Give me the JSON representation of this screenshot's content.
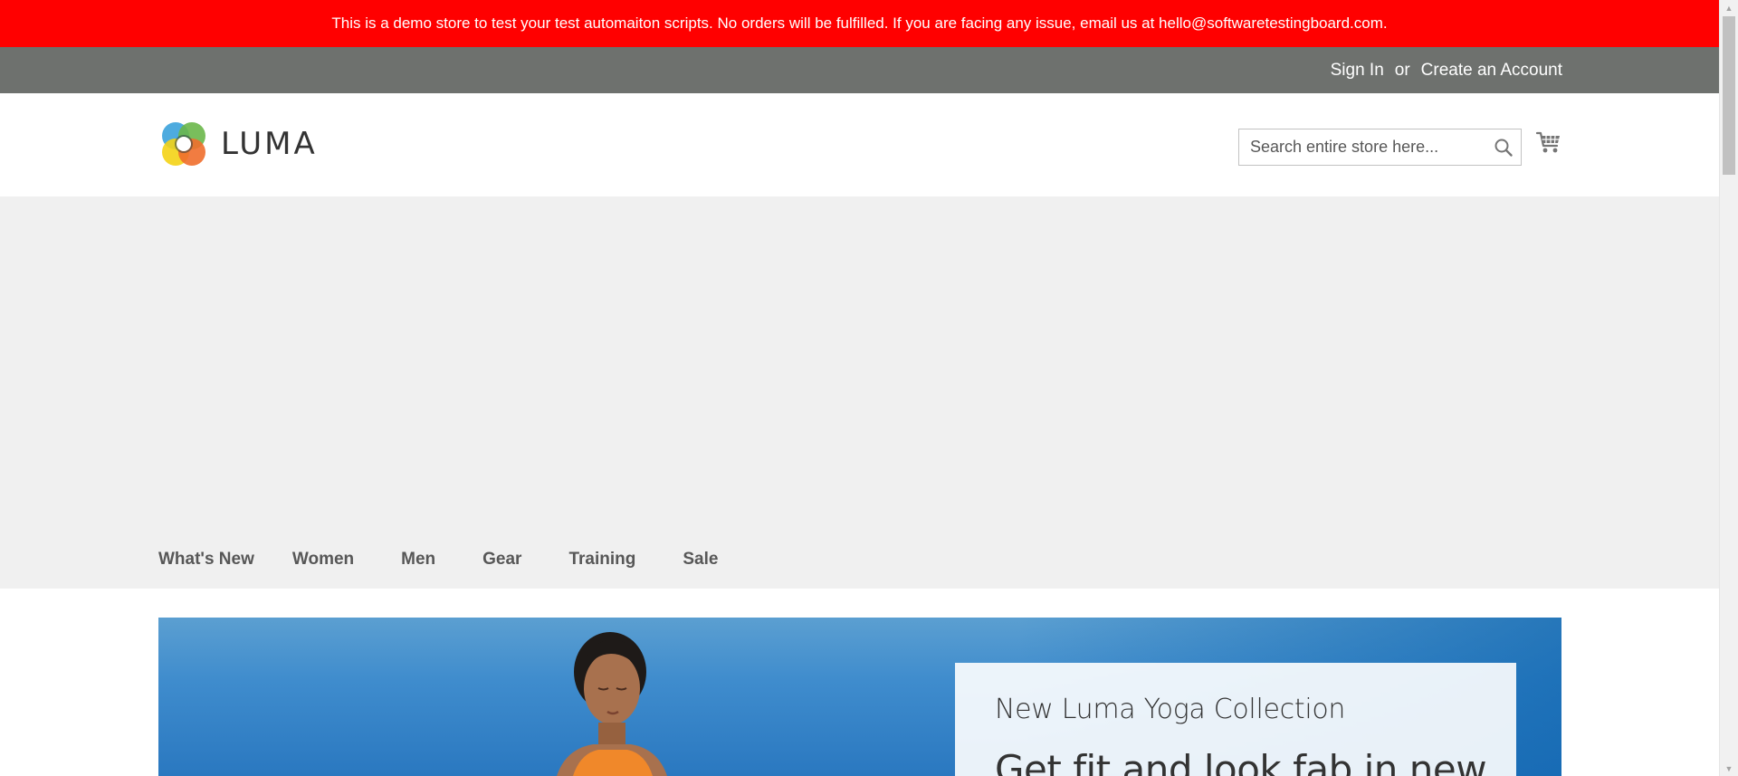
{
  "banner": {
    "text": "This is a demo store to test your test automaiton scripts. No orders will be fulfilled. If you are facing any issue, email us at hello@softwaretestingboard.com.",
    "background": "#ff0000"
  },
  "header_links": {
    "sign_in": "Sign In",
    "separator": "or",
    "create_account": "Create an Account"
  },
  "logo": {
    "text": "LUMA",
    "icon": "luma-logo-icon"
  },
  "search": {
    "placeholder": "Search entire store here...",
    "value": "",
    "icon": "search-icon"
  },
  "cart": {
    "icon": "cart-icon"
  },
  "nav": {
    "items": [
      {
        "label": "What's New"
      },
      {
        "label": "Women"
      },
      {
        "label": "Men"
      },
      {
        "label": "Gear"
      },
      {
        "label": "Training"
      },
      {
        "label": "Sale"
      }
    ]
  },
  "hero": {
    "eyebrow": "New Luma Yoga Collection",
    "headline": "Get fit and look fab in new"
  },
  "colors": {
    "panel_header": "#6e716e",
    "nav_background": "#f0f0f0",
    "nav_text": "#575757"
  }
}
